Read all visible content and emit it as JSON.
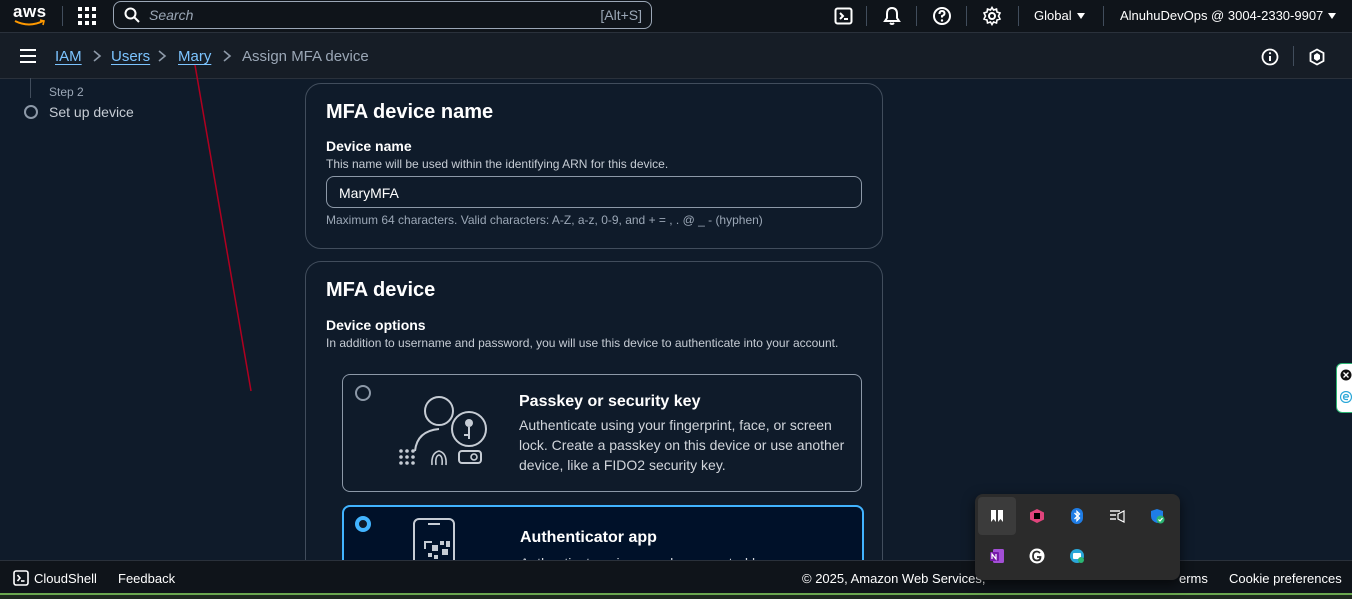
{
  "topbar": {
    "logo_text": "aws",
    "search_placeholder": "Search",
    "search_shortcut": "[Alt+S]",
    "region": "Global",
    "account": "AlnuhuDevOps @ 3004-2330-9907"
  },
  "breadcrumb": {
    "items": [
      "IAM",
      "Users",
      "Mary"
    ],
    "current": "Assign MFA device"
  },
  "steps": {
    "step_label": "Step 2",
    "step_title": "Set up device"
  },
  "device_name_panel": {
    "heading": "MFA device name",
    "field_label": "Device name",
    "field_description": "This name will be used within the identifying ARN for this device.",
    "field_value": "MaryMFA",
    "field_hint": "Maximum 64 characters. Valid characters: A-Z, a-z, 0-9, and + = , . @ _ - (hyphen)"
  },
  "mfa_device_panel": {
    "heading": "MFA device",
    "options_label": "Device options",
    "options_description": "In addition to username and password, you will use this device to authenticate into your account.",
    "options": [
      {
        "title": "Passkey or security key",
        "description": "Authenticate using your fingerprint, face, or screen lock. Create a passkey on this device or use another device, like a FIDO2 security key.",
        "selected": false
      },
      {
        "title": "Authenticator app",
        "description": "Authenticate using a code generated by an app",
        "selected": true
      }
    ]
  },
  "footer": {
    "cloudshell": "CloudShell",
    "feedback": "Feedback",
    "copyright": "© 2025, Amazon Web Services,",
    "terms": "erms",
    "cookie": "Cookie preferences"
  },
  "colors": {
    "accent": "#42b4ff",
    "link": "#7cc4ff",
    "background": "#0f1b2a",
    "topbar": "#0f141a"
  }
}
